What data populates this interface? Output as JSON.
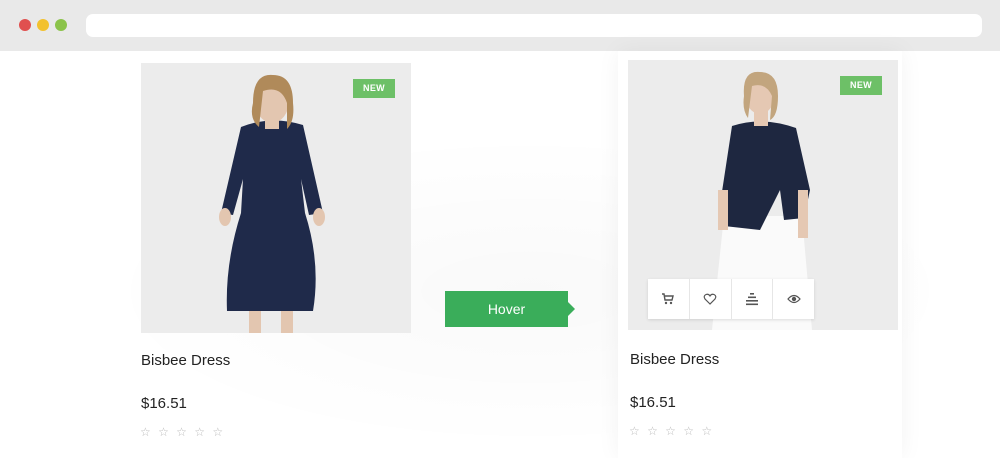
{
  "browser": {
    "url": ""
  },
  "hover_label": "Hover",
  "products": [
    {
      "name": "Bisbee Dress",
      "price": "$16.51",
      "badge": "NEW",
      "rating": 0,
      "stars": "☆ ☆ ☆ ☆ ☆"
    },
    {
      "name": "Bisbee Dress",
      "price": "$16.51",
      "badge": "NEW",
      "rating": 0,
      "stars": "☆ ☆ ☆ ☆ ☆"
    }
  ],
  "actions": [
    {
      "icon": "cart-icon"
    },
    {
      "icon": "heart-icon"
    },
    {
      "icon": "compare-icon"
    },
    {
      "icon": "eye-icon"
    }
  ],
  "colors": {
    "badge": "#6dc067",
    "hover_label": "#3aad5a",
    "image_bg": "#ececec"
  }
}
